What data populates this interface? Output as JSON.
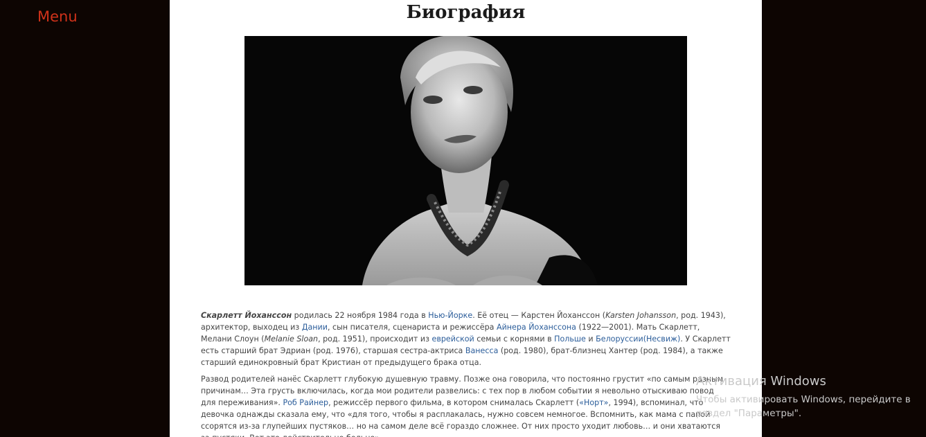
{
  "nav": {
    "menu_label": "Menu"
  },
  "page": {
    "title": "Биография"
  },
  "article": {
    "p1": {
      "name": "Скарлетт Йоханссон",
      "t1": " родилась 22 ноября 1984 года в ",
      "l1": "Нью-Йорке",
      "t2": ". Её отец — Карстен Йоханссон (",
      "i1": "Karsten Johansson",
      "t3": ", род. 1943), архитектор, выходец из ",
      "l2": "Дании",
      "t4": ", сын писателя, сценариста и режиссёра ",
      "l3": "Айнера Йоханссона",
      "t5": " (1922—2001). Мать Скарлетт, Мелани Слоун (",
      "i2": "Melanie Sloan",
      "t6": ", род. 1951), происходит из ",
      "l4": "еврейской",
      "t7": " семьи с корнями в ",
      "l5": "Польше",
      "t8": " и ",
      "l6": "Белоруссии(Несвиж)",
      "t9": ". У Скарлетт есть старший брат Эдриан (род. 1976), старшая сестра-актриса ",
      "l7": "Ванесса",
      "t10": " (род. 1980), брат-близнец Хантер (род. 1984), а также старший единокровный брат Кристиан от предыдущего брака отца."
    },
    "p2": {
      "t1": "Развод родителей нанёс Скарлетт глубокую душевную травму. Позже она говорила, что постоянно грустит «по самым разным причинам… Эта грусть включилась, когда мои родители развелись: с тех пор в любом событии я невольно отыскиваю повод для переживания». ",
      "l1": "Роб Райнер",
      "t2": ", режиссёр первого фильма, в котором снималась Скарлетт (",
      "l2": "«Норт»",
      "t3": ", 1994), вспоминал, что девочка однажды сказала ему, что «для того, чтобы я расплакалась, нужно совсем немногое. Вспомнить, как мама с папой ссорятся из-за глупейших пустяков… но на самом деле всё гораздо сложнее. От них просто уходит любовь… и они хватаются за пустяки. Вот это действительно больно»."
    }
  },
  "watermark": {
    "title": "Активация Windows",
    "text": "Чтобы активировать Windows, перейдите в раздел \"Параметры\"."
  },
  "colors": {
    "menu": "#d0321a",
    "background": "#0d0502",
    "link": "#2b5d9a"
  }
}
